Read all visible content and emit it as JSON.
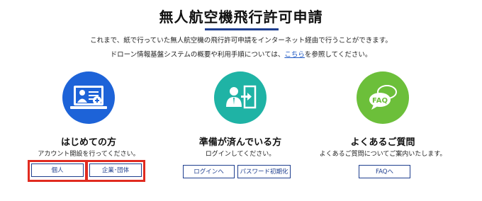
{
  "page": {
    "title": "無人航空機飛行許可申請",
    "intro_line1": "これまで、紙で行っていた無人航空機の飛行許可申請をインターネット経由で行うことができます。",
    "intro_line2_before": "ドローン情報基盤システムの概要や利用手順については、",
    "intro_line2_link": "こちら",
    "intro_line2_after": "を参照してください。",
    "accent_color": "#1f3f8f",
    "highlight_color": "#e12b20"
  },
  "sections": {
    "first_time": {
      "icon": "computer-user-icon",
      "color": "#1d63d8",
      "heading": "はじめての方",
      "description": "アカウント開設を行ってください。",
      "buttons": {
        "personal": "個人",
        "corporate": "企業･団体"
      }
    },
    "registered": {
      "icon": "user-login-door-icon",
      "color": "#1fb3a5",
      "heading": "準備が済んでいる方",
      "description": "ログインしてください。",
      "buttons": {
        "login": "ログインへ",
        "password_reset": "パスワード初期化"
      }
    },
    "faq": {
      "icon": "faq-speech-bubble-icon",
      "color": "#6cbf3a",
      "heading": "よくあるご質問",
      "description": "よくあるご質問についてご案内いたします。",
      "buttons": {
        "faq": "FAQへ"
      },
      "icon_label": "FAQ"
    }
  }
}
